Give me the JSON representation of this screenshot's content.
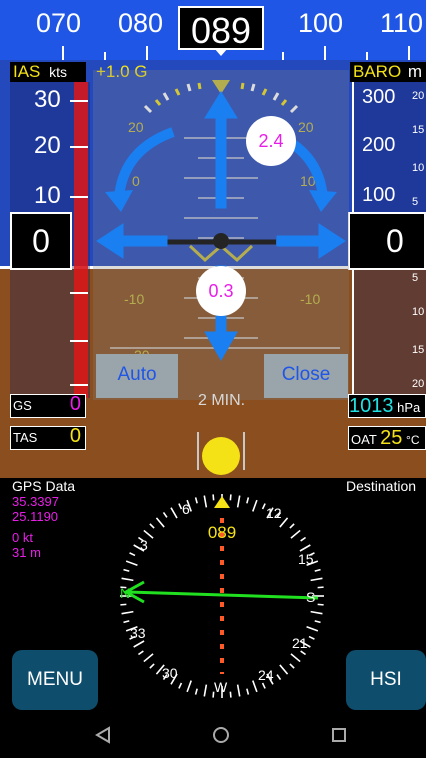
{
  "heading_tape": {
    "numbers": [
      "070",
      "080",
      "100",
      "110"
    ],
    "current": "089"
  },
  "ias": {
    "label": "IAS",
    "unit": "kts",
    "ticks": [
      "30",
      "20",
      "10"
    ],
    "value": "0"
  },
  "g_meter": {
    "text": "+1.0 G"
  },
  "baro": {
    "label": "BARO",
    "unit": "m",
    "ticks": [
      "300",
      "200",
      "100"
    ],
    "small_ticks": [
      "20",
      "15",
      "10",
      "5",
      "5",
      "10",
      "15",
      "20"
    ],
    "value": "0"
  },
  "attitude": {
    "pitch_labels": [
      "20",
      "20",
      "0",
      "10",
      "-10",
      "-10",
      "20"
    ],
    "timer_text": "2 MIN."
  },
  "overlay": {
    "value_top": "2.4",
    "value_bottom": "0.3",
    "auto_label": "Auto",
    "close_label": "Close"
  },
  "gs": {
    "label": "GS",
    "value": "0"
  },
  "tas": {
    "label": "TAS",
    "value": "0"
  },
  "pressure": {
    "value": "1013",
    "unit": "hPa"
  },
  "oat": {
    "label": "OAT",
    "value": "25",
    "unit": "°C"
  },
  "gps": {
    "title": "GPS Data",
    "lat": "35.3397",
    "lon": "25.1190",
    "speed": "0 kt",
    "alt": "31 m"
  },
  "destination": {
    "label": "Destination"
  },
  "hsi": {
    "heading": "089",
    "compass_labels": [
      "6",
      "12",
      "15",
      "S",
      "21",
      "24",
      "W",
      "30",
      "33",
      "N",
      "3"
    ]
  },
  "buttons": {
    "menu": "MENU",
    "hsi": "HSI"
  },
  "colors": {
    "sky": "#2449bd",
    "ground": "#8a4e1f",
    "accent_yellow": "#f4e217",
    "magenta": "#e81ee8",
    "cyan": "#22e3e3",
    "arrow_blue": "#1a7ff0",
    "course_green": "#20e020",
    "button": "#0f4d6d"
  },
  "icons": {
    "nav_back": "back-triangle-icon",
    "nav_home": "home-circle-icon",
    "nav_recent": "recent-square-icon"
  }
}
